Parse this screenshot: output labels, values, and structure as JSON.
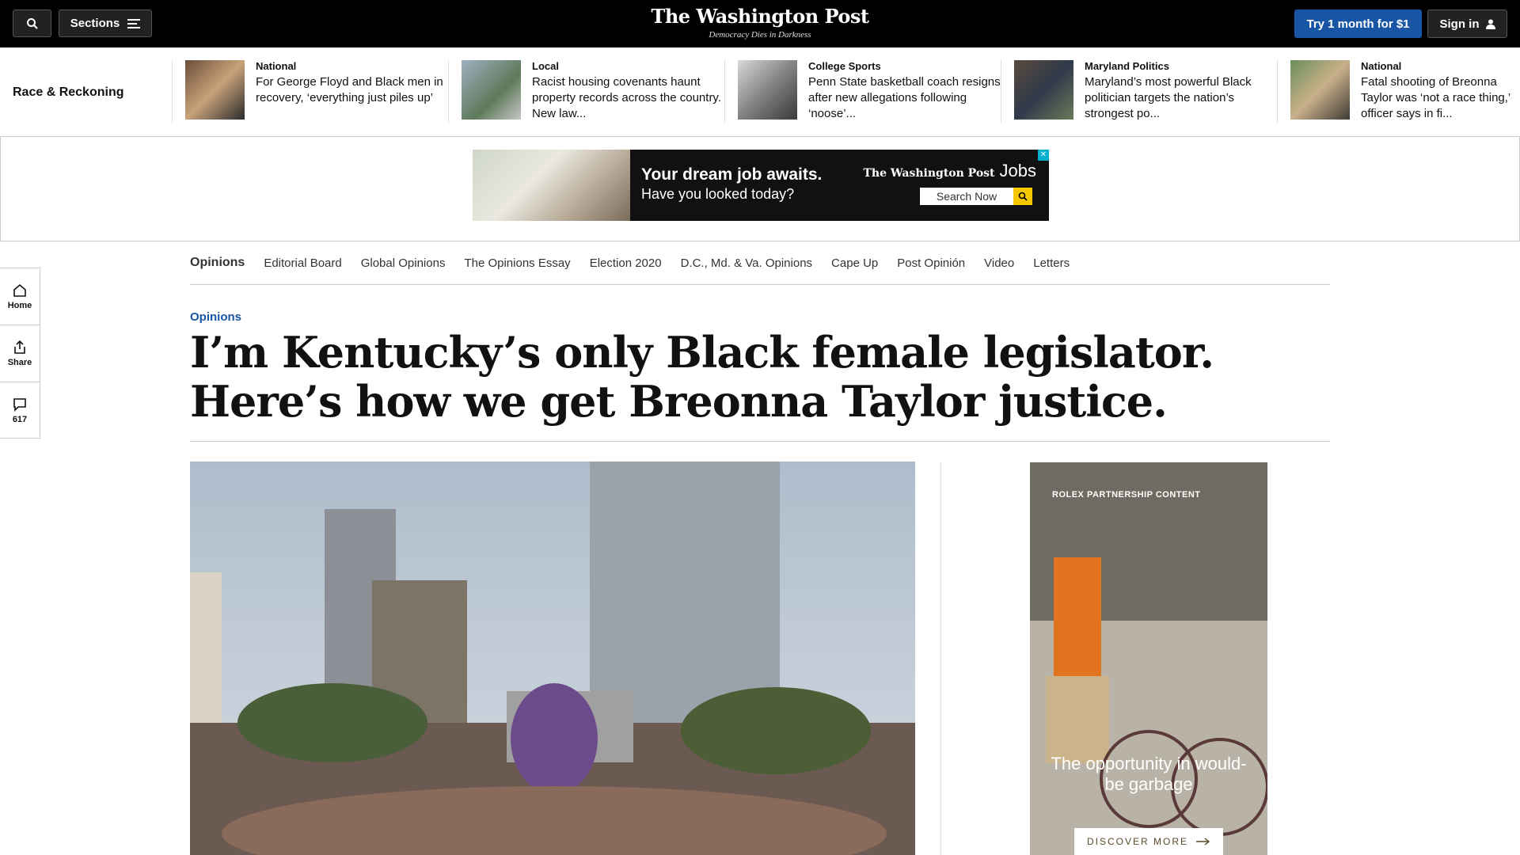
{
  "header": {
    "sections_label": "Sections",
    "logo": "The Washington Post",
    "tagline": "Democracy Dies in Darkness",
    "try_label": "Try 1 month for $1",
    "signin_label": "Sign in"
  },
  "strip": {
    "title": "Race & Reckoning",
    "items": [
      {
        "kicker": "National",
        "text": "For George Floyd and Black men in recovery, ‘everything just piles up’"
      },
      {
        "kicker": "Local",
        "text": "Racist housing covenants haunt property records across the country. New law..."
      },
      {
        "kicker": "College Sports",
        "text": "Penn State basketball coach resigns after new allegations following ‘noose’..."
      },
      {
        "kicker": "Maryland Politics",
        "text": "Maryland’s most powerful Black politician targets the nation’s strongest po..."
      },
      {
        "kicker": "National",
        "text": "Fatal shooting of Breonna Taylor was ‘not a race thing,’ officer says in fi..."
      }
    ]
  },
  "ad": {
    "headline": "Your dream job awaits.",
    "sub": "Have you looked today?",
    "brand": "The Washington Post",
    "brand2": "Jobs",
    "search_label": "Search Now"
  },
  "opnav": [
    "Opinions",
    "Editorial Board",
    "Global Opinions",
    "The Opinions Essay",
    "Election 2020",
    "D.C., Md. & Va. Opinions",
    "Cape Up",
    "Post Opinión",
    "Video",
    "Letters"
  ],
  "rail": {
    "home": "Home",
    "share": "Share",
    "comments": "617"
  },
  "article": {
    "kicker": "Opinions",
    "headline": "I’m Kentucky’s only Black female legislator. Here’s how we get Breonna Taylor justice."
  },
  "rolex": {
    "label": "ROLEX PARTNERSHIP CONTENT",
    "headline": "The opportunity in would-be garbage",
    "cta": "DISCOVER MORE"
  }
}
